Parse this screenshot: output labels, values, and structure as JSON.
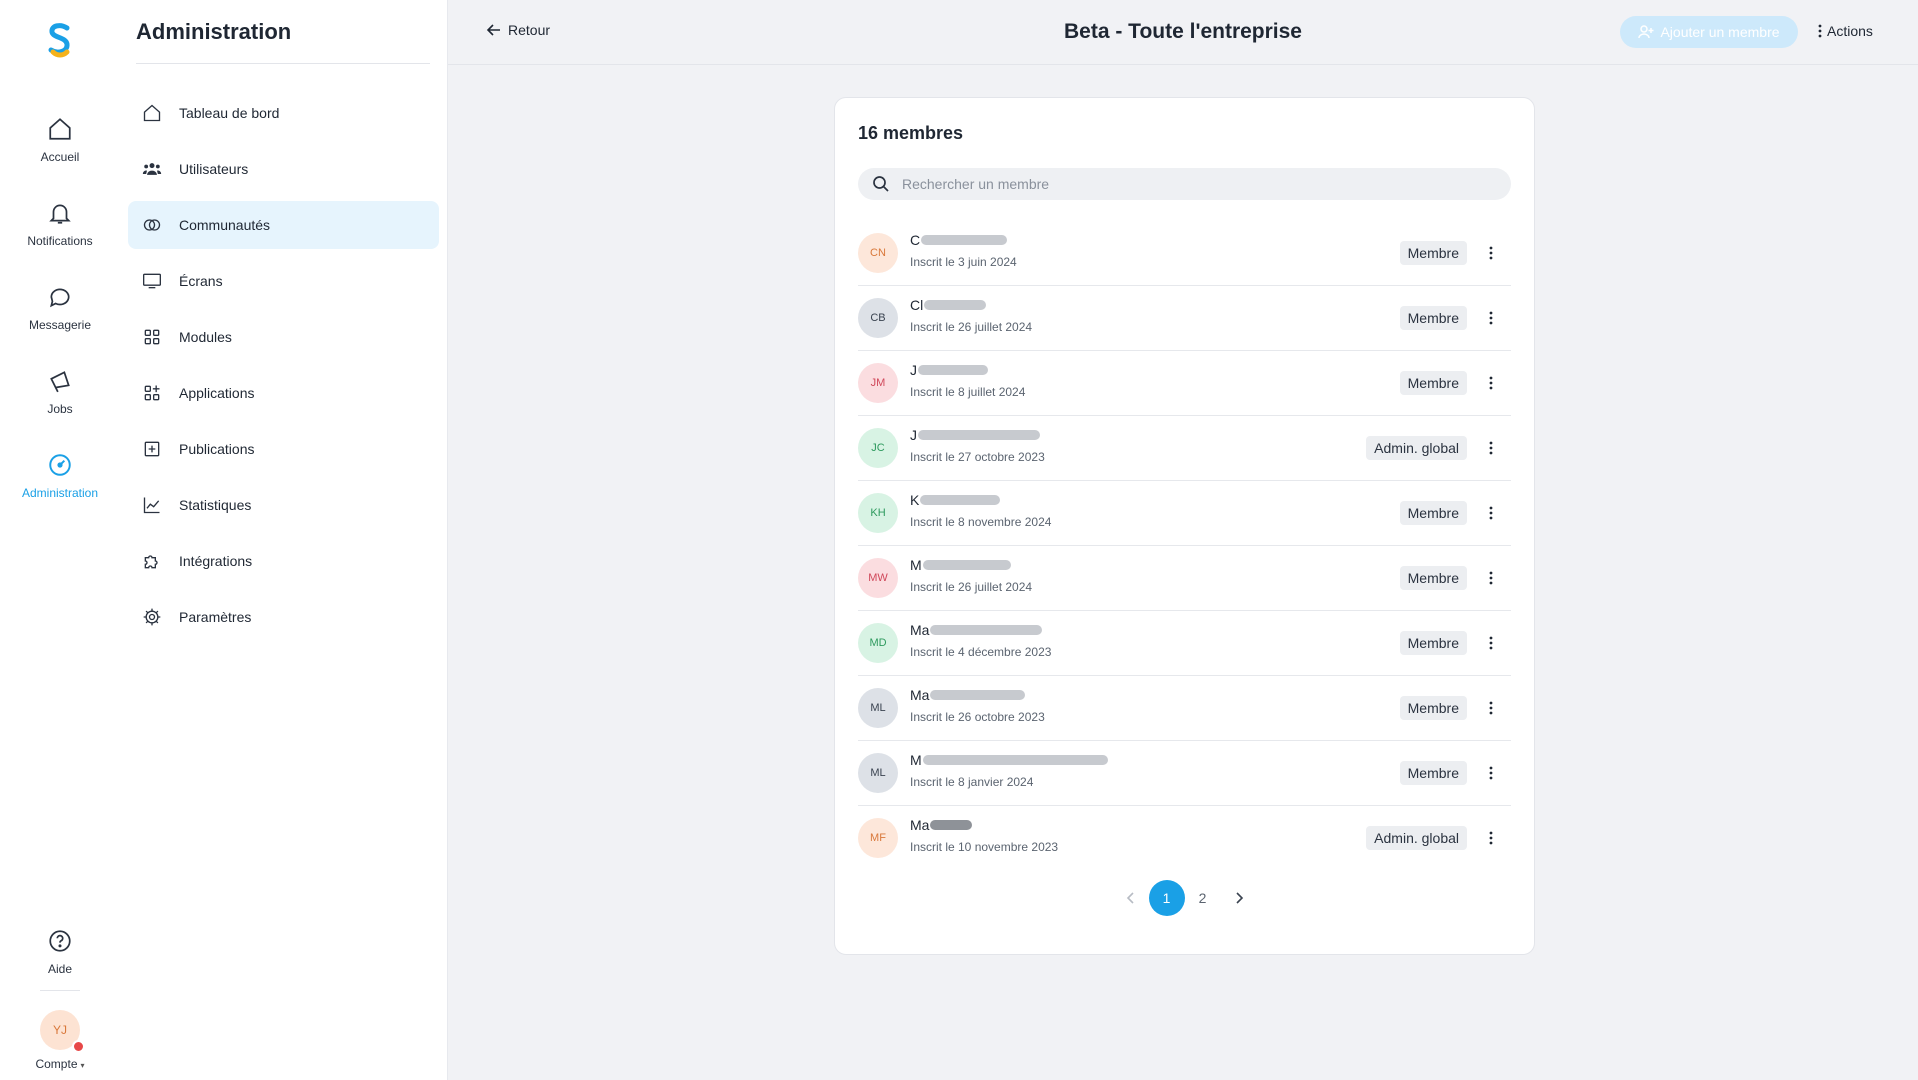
{
  "rail": {
    "items": [
      {
        "label": "Accueil"
      },
      {
        "label": "Notifications"
      },
      {
        "label": "Messagerie"
      },
      {
        "label": "Jobs"
      },
      {
        "label": "Administration",
        "active": true
      }
    ],
    "help_label": "Aide",
    "account": {
      "initials": "YJ",
      "label": "Compte"
    }
  },
  "sidebar": {
    "title": "Administration",
    "items": [
      {
        "label": "Tableau de bord",
        "icon": "home-icon"
      },
      {
        "label": "Utilisateurs",
        "icon": "users-icon"
      },
      {
        "label": "Communautés",
        "icon": "communities-icon",
        "active": true
      },
      {
        "label": "Écrans",
        "icon": "screen-icon"
      },
      {
        "label": "Modules",
        "icon": "modules-icon"
      },
      {
        "label": "Applications",
        "icon": "applications-icon"
      },
      {
        "label": "Publications",
        "icon": "publications-icon"
      },
      {
        "label": "Statistiques",
        "icon": "chart-icon"
      },
      {
        "label": "Intégrations",
        "icon": "puzzle-icon"
      },
      {
        "label": "Paramètres",
        "icon": "gear-icon"
      }
    ]
  },
  "header": {
    "back_label": "Retour",
    "title": "Beta - Toute l'entreprise",
    "add_member_label": "Ajouter un membre",
    "actions_label": "Actions"
  },
  "members": {
    "count_label": "16 membres",
    "search_placeholder": "Rechercher un membre",
    "rows": [
      {
        "initials": "CN",
        "name": "C",
        "date": "Inscrit le 3 juin 2024",
        "role": "Membre"
      },
      {
        "initials": "CB",
        "name": "Cl",
        "date": "Inscrit le 26 juillet 2024",
        "role": "Membre"
      },
      {
        "initials": "JM",
        "name": "J",
        "date": "Inscrit le 8 juillet 2024",
        "role": "Membre"
      },
      {
        "initials": "JC",
        "name": "J",
        "date": "Inscrit le 27 octobre 2023",
        "role": "Admin. global"
      },
      {
        "initials": "KH",
        "name": "K",
        "date": "Inscrit le 8 novembre 2024",
        "role": "Membre"
      },
      {
        "initials": "MW",
        "name": "M",
        "date": "Inscrit le 26 juillet 2024",
        "role": "Membre"
      },
      {
        "initials": "MD",
        "name": "Ma",
        "date": "Inscrit le 4 décembre 2023",
        "role": "Membre"
      },
      {
        "initials": "ML",
        "name": "Ma",
        "date": "Inscrit le 26 octobre 2023",
        "role": "Membre"
      },
      {
        "initials": "ML",
        "name": "M",
        "date": "Inscrit le 8 janvier 2024",
        "role": "Membre"
      },
      {
        "initials": "MF",
        "name": "Ma",
        "date": "Inscrit le 10 novembre 2023",
        "role": "Admin. global"
      }
    ]
  },
  "pagination": {
    "pages": [
      "1",
      "2"
    ],
    "current": "1"
  },
  "colors": {
    "accent": "#1aa0e6",
    "active_bg": "#e6f4fd",
    "avatar_orange_bg": "#fde7da",
    "avatar_orange_fg": "#d9783a",
    "avatar_gray_bg": "#dde1e7",
    "avatar_gray_fg": "#3a4350",
    "avatar_red_bg": "#fbdde0",
    "avatar_red_fg": "#d0485a",
    "avatar_green_bg": "#d8f3e4",
    "avatar_green_fg": "#2e9a5e"
  }
}
